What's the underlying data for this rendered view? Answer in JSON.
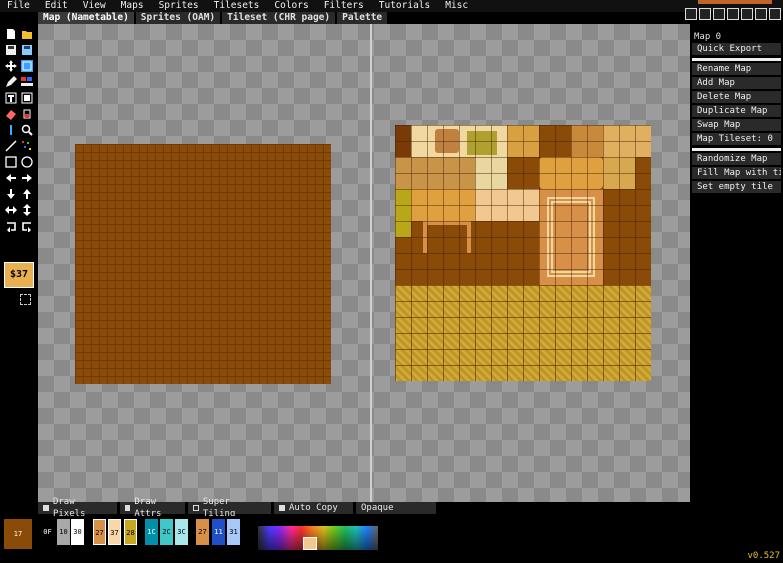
{
  "menu": [
    "File",
    "Edit",
    "View",
    "Maps",
    "Sprites",
    "Tilesets",
    "Colors",
    "Filters",
    "Tutorials",
    "Misc"
  ],
  "tabs": [
    "Map (Nametable)",
    "Sprites (OAM)",
    "Tileset (CHR page)",
    "Palette"
  ],
  "active_tab": 0,
  "toolbar": {
    "money_label": "$37"
  },
  "right_panel": {
    "map_label": "Map 0",
    "quick_export": "Quick Export",
    "map_buttons": [
      "Rename Map",
      "Add Map",
      "Delete Map",
      "Duplicate Map",
      "Swap Map",
      "Map Tileset: 0"
    ],
    "tile_buttons": [
      "Randomize Map",
      "Fill Map with tile",
      "Set empty tile"
    ]
  },
  "modes": [
    {
      "label": "Draw Pixels",
      "checked": true
    },
    {
      "label": "Draw Attrs",
      "checked": true
    },
    {
      "label": "Super Tiling",
      "checked": false
    },
    {
      "label": "Auto Copy",
      "checked": true
    },
    {
      "label": "Opaque",
      "checked": null
    }
  ],
  "palette": {
    "main": "17",
    "swatches": [
      "0F",
      "10",
      "30",
      "27",
      "37",
      "28",
      "1C",
      "2C",
      "3C",
      "27",
      "11",
      "31"
    ],
    "colors": [
      "#000000",
      "#a8a8a8",
      "#ffffff",
      "#d89048",
      "#f8d8a8",
      "#c8a820",
      "#0090a8",
      "#40c8c8",
      "#a8e8e8",
      "#d89048",
      "#2050c8",
      "#a8c8f8"
    ]
  },
  "status": {
    "version": "v0.527"
  },
  "colors": {
    "nametable_brown": "#8a4a08",
    "orange": "#c0642a"
  }
}
